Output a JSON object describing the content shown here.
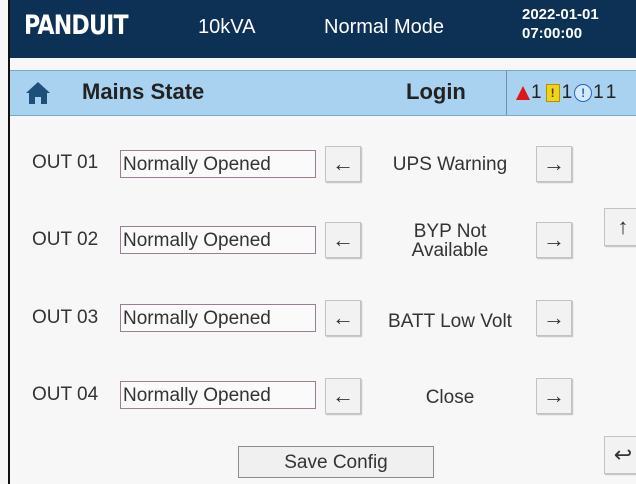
{
  "header": {
    "brand": "PANDUIT",
    "capacity": "10kVA",
    "mode": "Normal Mode",
    "date": "2022-01-01",
    "time": "07:00:00"
  },
  "subheader": {
    "home_icon": "home-icon",
    "title": "Mains State",
    "login_label": "Login",
    "alarm_count": "1",
    "warning_count": "1",
    "info_count": "1",
    "overflow_count": "1",
    "colors": {
      "alarm": "#e1141a",
      "warning": "#f1d11c",
      "info": "#2366c7"
    }
  },
  "outputs": [
    {
      "label": "OUT 01",
      "value": "Normally Opened",
      "event": "UPS Warning"
    },
    {
      "label": "OUT 02",
      "value": "Normally Opened",
      "event_line1": "BYP Not",
      "event_line2": "Available"
    },
    {
      "label": "OUT 03",
      "value": "Normally Opened",
      "event": "BATT Low Volt"
    },
    {
      "label": "OUT 04",
      "value": "Normally Opened",
      "event": "Close"
    }
  ],
  "icons": {
    "left": "←",
    "right": "→",
    "up": "↑",
    "back": "↩"
  },
  "save_label": "Save Config",
  "colors": {
    "header_bg": "#0d3155",
    "subbar_bg": "#a9d2f0"
  }
}
